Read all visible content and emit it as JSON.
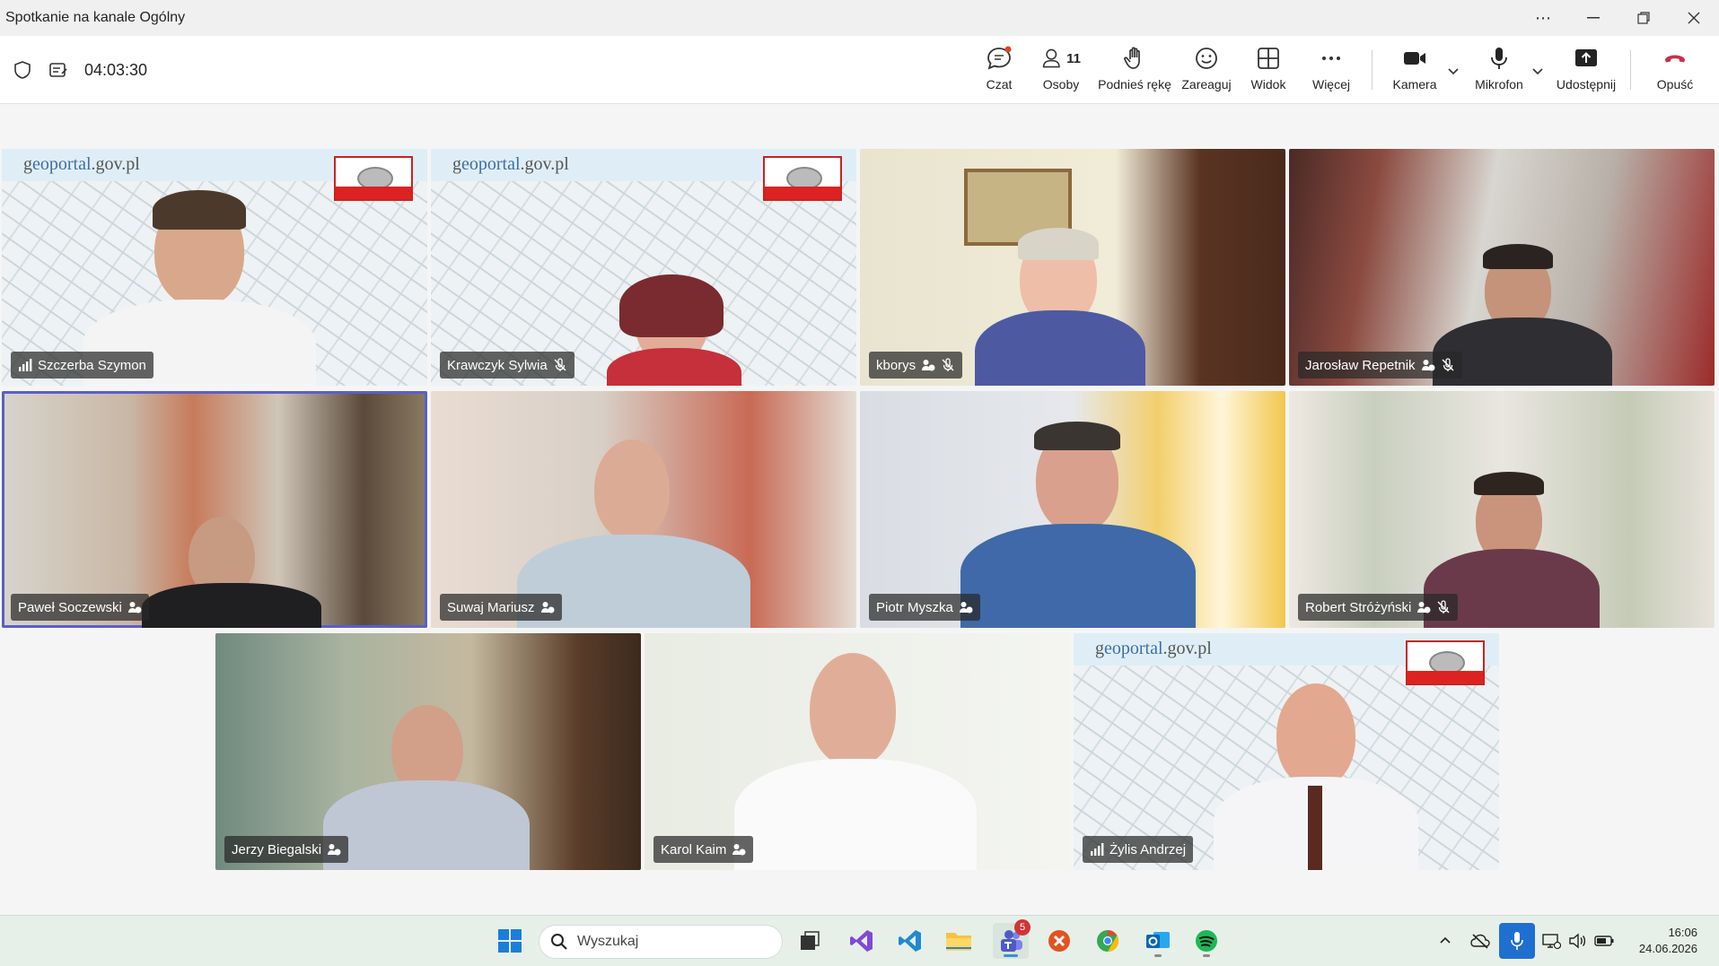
{
  "window": {
    "title": "Spotkanie na kanale Ogólny"
  },
  "meeting": {
    "timer": "04:03:30",
    "people_count": "11"
  },
  "toolbar": {
    "chat": "Czat",
    "people": "Osoby",
    "raise_hand": "Podnieś rękę",
    "react": "Zareaguj",
    "view": "Widok",
    "more": "Więcej",
    "camera": "Kamera",
    "mic": "Mikrofon",
    "share": "Udostępnij",
    "leave": "Opuść"
  },
  "participants": [
    {
      "name": "Szczerba Szymon",
      "status": "speaking"
    },
    {
      "name": "Krawczyk Sylwia",
      "status": "muted"
    },
    {
      "name": "kborys",
      "status": "muted"
    },
    {
      "name": "Jarosław Repetnik",
      "status": "muted"
    },
    {
      "name": "Paweł Soczewski",
      "status": "active"
    },
    {
      "name": "Suwaj Mariusz",
      "status": ""
    },
    {
      "name": "Piotr Myszka",
      "status": ""
    },
    {
      "name": "Robert Stróżyński",
      "status": "muted"
    },
    {
      "name": "Jerzy Biegalski",
      "status": ""
    },
    {
      "name": "Karol Kaim",
      "status": ""
    },
    {
      "name": "Żylis Andrzej",
      "status": "speaking"
    }
  ],
  "geoportal": {
    "logo_prefix": "g",
    "logo_main": "eoportal",
    "logo_suffix": ".gov.pl"
  },
  "taskbar": {
    "search_placeholder": "Wyszukaj",
    "teams_badge": "5",
    "time": "16:06",
    "date": "24.06.2026"
  },
  "colors": {
    "accent": "#5b5fc7",
    "leave": "#c4314b",
    "mic_active": "#1f6fd1"
  }
}
